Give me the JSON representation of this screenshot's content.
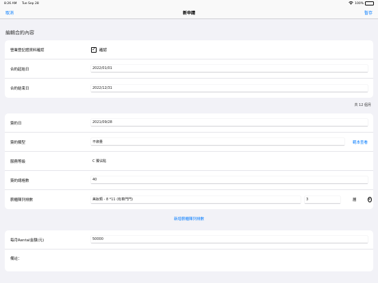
{
  "status": {
    "time": "8:26 AM",
    "date": "Tue Sep 28",
    "battery": "100%"
  },
  "nav": {
    "cancel": "取消",
    "title": "新申請",
    "save": "暫存"
  },
  "section_title": "編輯合約內容",
  "card1": {
    "verify_label": "營業登記證資料確認",
    "verify_check_label": "確認",
    "start_label": "合約起始日",
    "start_value": "2022/01/01",
    "end_label": "合約結束日",
    "end_value": "2022/12/31"
  },
  "months_note": "共 12 個月",
  "card2": {
    "sign_date_label": "簽約日",
    "sign_date_value": "2021/09/28",
    "type_label": "簽約類型",
    "type_value": "不綁量",
    "type_link": "範本查看",
    "level_label": "服務等級",
    "level_value": "C 獨佔點",
    "total_label": "簽約總格數",
    "total_value": "40",
    "cabinet_label": "薪櫃陳列排數",
    "cabinet_value": "美妝類 - 8 *11 (有車門門)",
    "cabinet_qty": "3",
    "cabinet_unit": "層"
  },
  "add_cabinet": "新增薪櫃陳列排數",
  "card3": {
    "rental_label": "每月Rental金額(元)",
    "rental_value": "50000",
    "notes_label": "備註："
  }
}
